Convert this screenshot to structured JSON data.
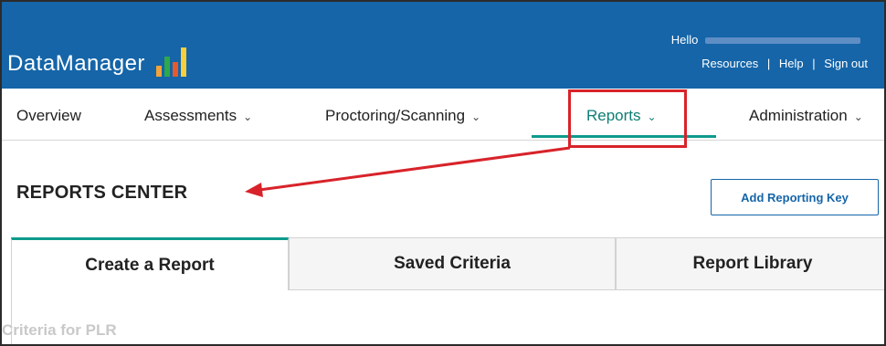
{
  "header": {
    "logo_text": "DataManager",
    "logo_bar_colors": [
      "#f2a33a",
      "#2ea84a",
      "#e85a2a",
      "#f6cf3b"
    ],
    "greeting": "Hello",
    "links": [
      "Resources",
      "Help",
      "Sign out"
    ]
  },
  "nav": {
    "items": [
      {
        "label": "Overview",
        "has_dropdown": false
      },
      {
        "label": "Assessments",
        "has_dropdown": true
      },
      {
        "label": "Proctoring/Scanning",
        "has_dropdown": true
      },
      {
        "label": "Reports",
        "has_dropdown": true,
        "active": true
      },
      {
        "label": "Administration",
        "has_dropdown": true
      }
    ]
  },
  "page": {
    "title": "REPORTS CENTER",
    "add_key_button": "Add Reporting Key"
  },
  "tabs": [
    {
      "label": "Create a Report",
      "active": true
    },
    {
      "label": "Saved Criteria",
      "active": false
    },
    {
      "label": "Report Library",
      "active": false
    }
  ],
  "content": {
    "criteria_label": "Criteria for PLR"
  },
  "colors": {
    "header_bg": "#1565a8",
    "accent_teal": "#0e9a8c",
    "annotation_red": "#d8232a"
  }
}
